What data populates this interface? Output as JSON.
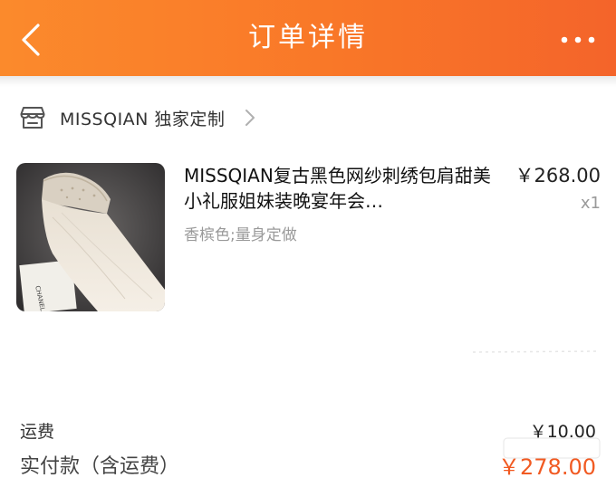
{
  "header": {
    "title": "订单详情",
    "back_icon": "chevron-left-icon",
    "more_icon": "more-dots-icon",
    "gradient_start": "#fb8a2c",
    "gradient_end": "#f4642a"
  },
  "shop": {
    "icon": "store-icon",
    "name": "MISSQIAN 独家定制",
    "chevron_icon": "chevron-right-icon"
  },
  "order_item": {
    "image": "dress-product-image",
    "title": "MISSQIAN复古黑色网纱刺绣包肩甜美小礼服姐妹装晚宴年会…",
    "sku": "香槟色;量身定做",
    "price": "￥268.00",
    "quantity": "x1"
  },
  "summary": {
    "freight_label": "运费",
    "freight_value": "￥10.00",
    "paid_label": "实付款（含运费）",
    "paid_value": "￥278.00",
    "paid_color": "#f15a22"
  }
}
